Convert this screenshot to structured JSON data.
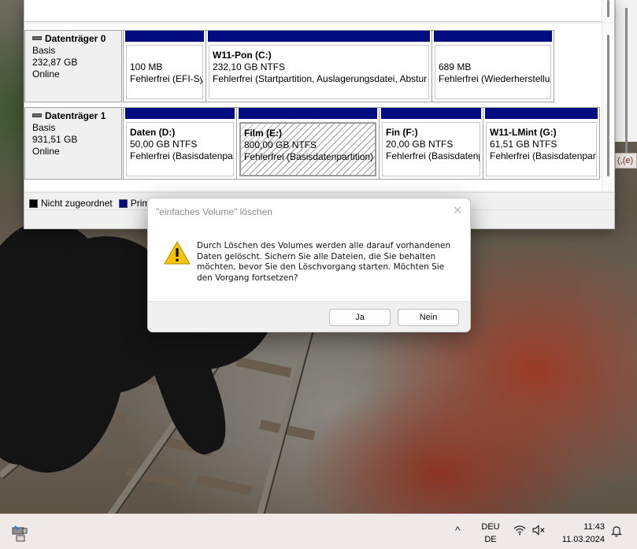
{
  "disk_management": {
    "disks": [
      {
        "name": "Datenträger 0",
        "type": "Basis",
        "size": "232,87 GB",
        "status": "Online",
        "partitions": [
          {
            "title": "",
            "size": "100 MB",
            "status": "Fehlerfrei (EFI-Sys"
          },
          {
            "title": "W11-Pon  (C:)",
            "size": "232,10 GB NTFS",
            "status": "Fehlerfrei (Startpartition, Auslagerungsdatei, Abstur"
          },
          {
            "title": "",
            "size": "689 MB",
            "status": "Fehlerfrei (Wiederherstellu"
          }
        ]
      },
      {
        "name": "Datenträger 1",
        "type": "Basis",
        "size": "931,51 GB",
        "status": "Online",
        "partitions": [
          {
            "title": "Daten  (D:)",
            "size": "50,00 GB NTFS",
            "status": "Fehlerfrei (Basisdatenpar"
          },
          {
            "title": "Film  (E:)",
            "size": "800,00 GB NTFS",
            "status": "Fehlerfrei (Basisdatenpartition)"
          },
          {
            "title": "Fin  (F:)",
            "size": "20,00 GB NTFS",
            "status": "Fehlerfrei (Basisdatenp"
          },
          {
            "title": "W11-LMint  (G:)",
            "size": "61,51 GB NTFS",
            "status": "Fehlerfrei (Basisdatenpart"
          }
        ]
      }
    ],
    "legend": [
      {
        "label": "Nicht zugeordnet",
        "color": "#000000"
      },
      {
        "label": "Primäre Partition",
        "color": "#000c80"
      }
    ]
  },
  "right_edge_chip": "(,(e)",
  "dialog": {
    "title": "\"einfaches Volume\" löschen",
    "close_symbol": "✕",
    "message": "Durch Löschen des Volumes werden alle darauf vorhandenen Daten gelöscht. Sichern Sie alle Dateien, die Sie behalten möchten, bevor Sie den Löschvorgang starten. Möchten Sie den Vorgang fortsetzen?",
    "yes_label": "Ja",
    "no_label": "Nein",
    "icon": "warning-icon"
  },
  "taskbar": {
    "language_top": "DEU",
    "language_bottom": "DE",
    "time": "11:43",
    "date": "11.03.2024",
    "icons": [
      "usb-eject-icon",
      "chevron-up-icon",
      "wifi-icon",
      "speaker-muted-icon",
      "bell-icon"
    ]
  },
  "colors": {
    "primary_partition": "#000c80",
    "warning": "#f6c400"
  }
}
